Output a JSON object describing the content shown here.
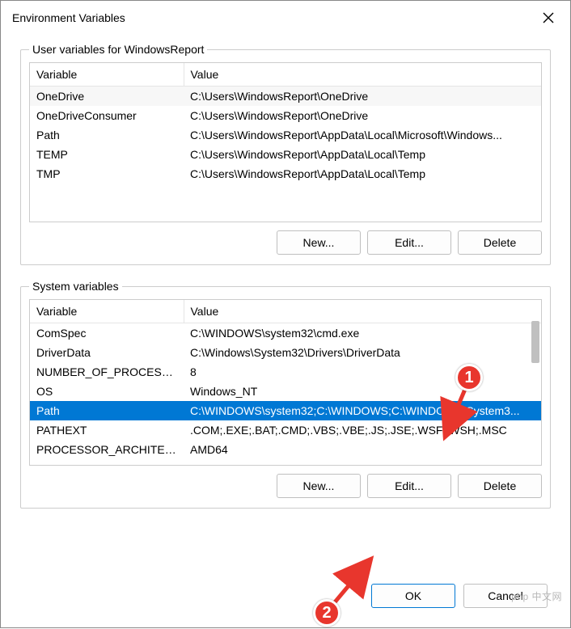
{
  "window": {
    "title": "Environment Variables"
  },
  "user_group": {
    "legend": "User variables for WindowsReport",
    "headers": [
      "Variable",
      "Value"
    ],
    "rows": [
      {
        "var": "OneDrive",
        "val": "C:\\Users\\WindowsReport\\OneDrive",
        "alt": true
      },
      {
        "var": "OneDriveConsumer",
        "val": "C:\\Users\\WindowsReport\\OneDrive"
      },
      {
        "var": "Path",
        "val": "C:\\Users\\WindowsReport\\AppData\\Local\\Microsoft\\Windows..."
      },
      {
        "var": "TEMP",
        "val": "C:\\Users\\WindowsReport\\AppData\\Local\\Temp"
      },
      {
        "var": "TMP",
        "val": "C:\\Users\\WindowsReport\\AppData\\Local\\Temp"
      }
    ]
  },
  "sys_group": {
    "legend": "System variables",
    "headers": [
      "Variable",
      "Value"
    ],
    "rows": [
      {
        "var": "ComSpec",
        "val": "C:\\WINDOWS\\system32\\cmd.exe"
      },
      {
        "var": "DriverData",
        "val": "C:\\Windows\\System32\\Drivers\\DriverData"
      },
      {
        "var": "NUMBER_OF_PROCESSORS",
        "val": "8"
      },
      {
        "var": "OS",
        "val": "Windows_NT"
      },
      {
        "var": "Path",
        "val": "C:\\WINDOWS\\system32;C:\\WINDOWS;C:\\WINDOWS\\System3...",
        "selected": true
      },
      {
        "var": "PATHEXT",
        "val": ".COM;.EXE;.BAT;.CMD;.VBS;.VBE;.JS;.JSE;.WSF;.WSH;.MSC"
      },
      {
        "var": "PROCESSOR_ARCHITECTU...",
        "val": "AMD64"
      }
    ]
  },
  "buttons": {
    "new": "New...",
    "edit": "Edit...",
    "delete": "Delete",
    "ok": "OK",
    "cancel": "Cancel"
  },
  "annotations": {
    "marker1": "1",
    "marker2": "2"
  },
  "watermark": "php 中文网"
}
